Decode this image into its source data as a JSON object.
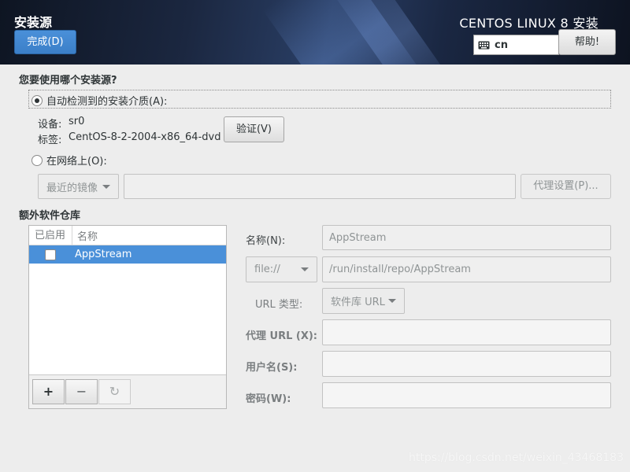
{
  "header": {
    "title": "安装源",
    "done_label": "完成(D)",
    "product": "CENTOS LINUX 8 安装",
    "keyboard_layout": "cn",
    "help_label": "帮助!"
  },
  "source": {
    "question": "您要使用哪个安装源?",
    "auto_media_label": "自动检测到的安装介质(A):",
    "auto_media_selected": true,
    "device_label": "设备:",
    "device_value": "sr0",
    "tag_label": "标签:",
    "tag_value": "CentOS-8-2-2004-x86_64-dvd",
    "verify_label": "验证(V)",
    "network_label": "在网络上(O):",
    "network_selected": false,
    "mirror_combo": "最近的镜像",
    "url_value": "",
    "proxy_button": "代理设置(P)..."
  },
  "repos": {
    "title": "额外软件仓库",
    "col_enabled": "已启用",
    "col_name": "名称",
    "items": [
      {
        "enabled": false,
        "name": "AppStream",
        "selected": true
      }
    ],
    "add_label": "+",
    "remove_label": "−",
    "refresh_label": "↻"
  },
  "repo_detail": {
    "name_label": "名称(N):",
    "name_value": "AppStream",
    "protocol": "file://",
    "url_value": "/run/install/repo/AppStream",
    "url_type_label": "URL 类型:",
    "url_type_value": "软件库 URL",
    "proxy_label": "代理 URL (X):",
    "proxy_value": "",
    "username_label": "用户名(S):",
    "username_value": "",
    "password_label": "密码(W):",
    "password_value": ""
  },
  "watermark": "https://blog.csdn.net/weixin_43468183",
  "colors": {
    "accent": "#4a90d9",
    "header_bg": "#1b2740",
    "window_bg": "#ededed"
  }
}
